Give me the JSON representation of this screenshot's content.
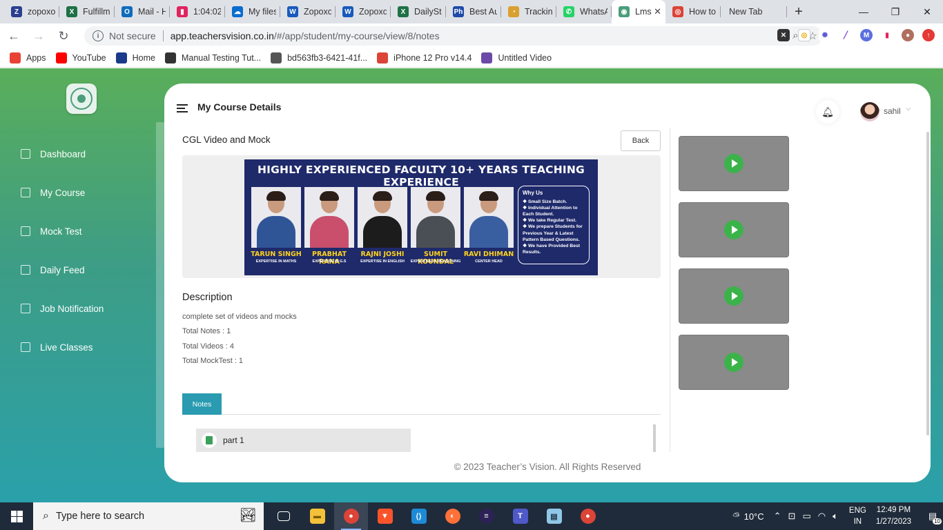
{
  "browser": {
    "tabs": [
      {
        "title": "zopoxo",
        "icon": "z-app-icon",
        "color": "#2a3f8f",
        "glyph": "Z"
      },
      {
        "title": "Fulfillme",
        "icon": "excel-icon",
        "color": "#1e7145",
        "glyph": "X"
      },
      {
        "title": "Mail - H",
        "icon": "outlook-icon",
        "color": "#0f6cbd",
        "glyph": "O"
      },
      {
        "title": "1:04:02",
        "icon": "recorder-icon",
        "color": "#e0245e",
        "glyph": "▮"
      },
      {
        "title": "My files",
        "icon": "onedrive-icon",
        "color": "#0a6ccf",
        "glyph": "☁"
      },
      {
        "title": "Zopoxo",
        "icon": "word-icon",
        "color": "#185abd",
        "glyph": "W"
      },
      {
        "title": "Zopoxo",
        "icon": "word-icon",
        "color": "#185abd",
        "glyph": "W"
      },
      {
        "title": "DailySta",
        "icon": "excel-icon",
        "color": "#1e7145",
        "glyph": "X"
      },
      {
        "title": "Best Au",
        "icon": "ph-icon",
        "color": "#1e4aa8",
        "glyph": "Ph"
      },
      {
        "title": "Tracking",
        "icon": "tracking-icon",
        "color": "#d9a030",
        "glyph": "◔"
      },
      {
        "title": "WhatsA",
        "icon": "whatsapp-icon",
        "color": "#25d366",
        "glyph": "✆"
      },
      {
        "title": "Lms",
        "icon": "lms-icon",
        "color": "#4a9e7a",
        "glyph": "◉",
        "active": true
      },
      {
        "title": "How to",
        "icon": "chrome-icon",
        "color": "#db4437",
        "glyph": "◎"
      },
      {
        "title": "New Tab",
        "icon": "",
        "color": "",
        "glyph": ""
      }
    ],
    "close_label": "✕",
    "new_tab_label": "+",
    "window_controls": [
      "—",
      "❐",
      "✕"
    ],
    "not_secure": "Not secure",
    "url_host": "app.teachersvision.co.in",
    "url_path": "/#/app/student/my-course/view/8/notes",
    "bookmarks": [
      {
        "label": "Apps",
        "icon": "apps-grid-icon",
        "color": "#e94235"
      },
      {
        "label": "YouTube",
        "icon": "youtube-icon",
        "color": "#ff0000"
      },
      {
        "label": "Home",
        "icon": "home-bookmark-icon",
        "color": "#1a3a8a"
      },
      {
        "label": "Manual Testing Tut...",
        "icon": "site-icon",
        "color": "#333333"
      },
      {
        "label": "bd563fb3-6421-41f...",
        "icon": "globe-icon",
        "color": "#555555"
      },
      {
        "label": "iPhone 12 Pro v14.4",
        "icon": "chrome-icon",
        "color": "#db4437"
      },
      {
        "label": "Untitled Video",
        "icon": "video-bookmark-icon",
        "color": "#6b4aa8"
      }
    ]
  },
  "sidebar": {
    "items": [
      {
        "label": "Dashboard",
        "icon": "home-icon"
      },
      {
        "label": "My Course",
        "icon": "course-icon"
      },
      {
        "label": "Mock Test",
        "icon": "test-icon"
      },
      {
        "label": "Daily Feed",
        "icon": "feed-icon"
      },
      {
        "label": "Job Notification",
        "icon": "job-icon"
      },
      {
        "label": "Live Classes",
        "icon": "live-icon"
      }
    ]
  },
  "header": {
    "title": "My Course Details",
    "user_name": "sahil"
  },
  "course": {
    "title": "CGL Video and Mock",
    "back_label": "Back",
    "banner": {
      "heading": "HIGHLY EXPERIENCED FACULTY 10+ YEARS TEACHING EXPERIENCE",
      "faculty": [
        {
          "name": "TARUN SINGH",
          "expertise": "EXPERTISE IN MATHS",
          "shirt": "#2f5597"
        },
        {
          "name": "PRABHAT RANA",
          "expertise": "EXPERTISE IN G.S",
          "shirt": "#c94f6d"
        },
        {
          "name": "RAJNI JOSHI",
          "expertise": "EXPERTISE IN ENGLISH",
          "shirt": "#1c1c1c"
        },
        {
          "name": "SUMIT KOUNDAL",
          "expertise": "EXPERTISE IN REASONING",
          "shirt": "#4a4f55"
        },
        {
          "name": "RAVI DHIMAN",
          "expertise": "CENTER HEAD",
          "shirt": "#3a5fa0"
        }
      ],
      "why_title": "Why Us",
      "why_points": [
        "❖ Small Size Batch.",
        "❖ Individual Attention to Each Student.",
        "❖ We take Regular Test.",
        "❖ We prepare Students for Previous Year & Latest Pattern Based Questions.",
        "❖ We have Provided Best Results."
      ]
    },
    "description_title": "Description",
    "description": "complete set of videos and mocks",
    "total_notes": "Total Notes : 1",
    "total_videos": "Total Videos : 4",
    "total_mocktest": "Total MockTest : 1",
    "tab_notes": "Notes",
    "notes": [
      {
        "label": "part 1"
      }
    ]
  },
  "videos": [
    {
      "id": 1
    },
    {
      "id": 2
    },
    {
      "id": 3
    },
    {
      "id": 4
    }
  ],
  "footer": "© 2023 Teacher’s Vision. All Rights Reserved",
  "taskbar": {
    "search_placeholder": "Type here to search",
    "weather": "10°C",
    "lang_top": "ENG",
    "lang_bottom": "IN",
    "time": "12:49 PM",
    "date": "1/27/2023",
    "notification_count": "10"
  },
  "colors": {
    "accent": "#2a9bb0",
    "play": "#3bb34a",
    "banner_bg": "#1f2a6b",
    "banner_name": "#ffd21f"
  }
}
